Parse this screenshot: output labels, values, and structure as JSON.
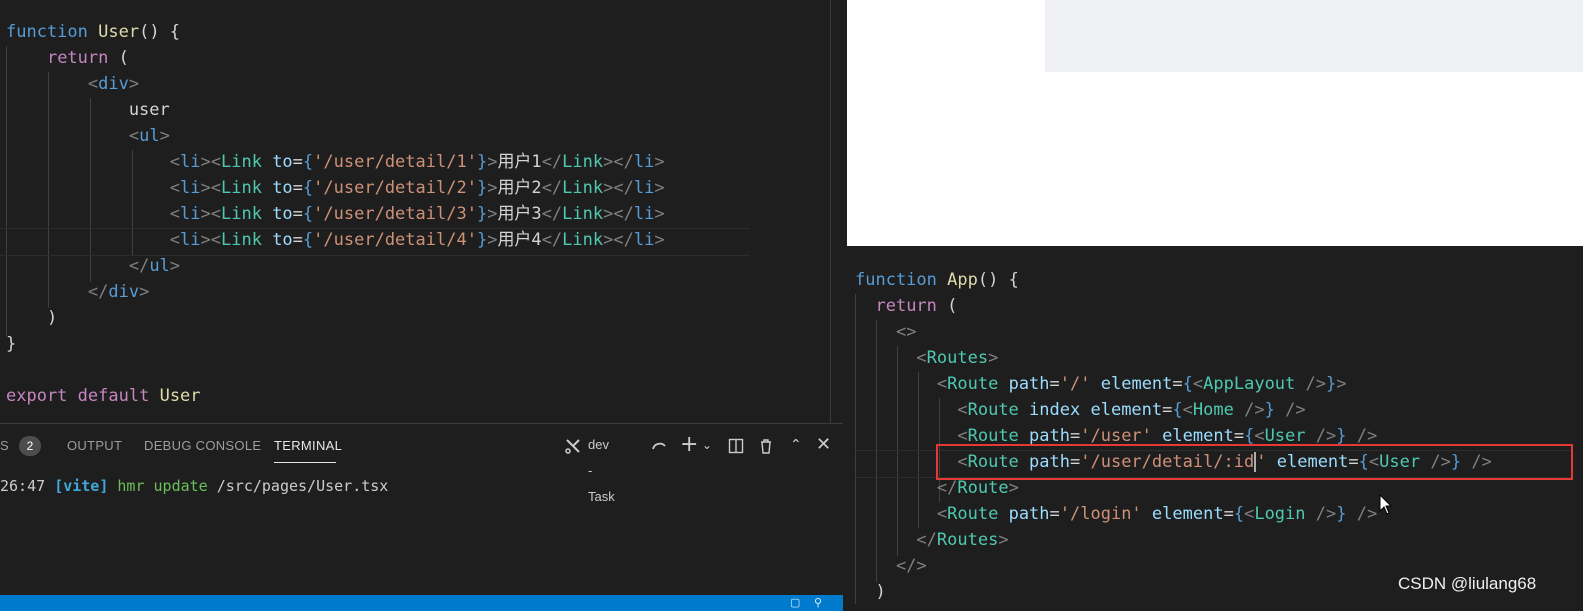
{
  "left_editor": {
    "lines": [
      [
        [
          "kw",
          "function"
        ],
        [
          "txt",
          " "
        ],
        [
          "fn",
          "User"
        ],
        [
          "txt",
          "() {"
        ]
      ],
      [
        [
          "txt",
          "    "
        ],
        [
          "kw2",
          "return"
        ],
        [
          "txt",
          " ("
        ]
      ],
      [
        [
          "txt",
          "        "
        ],
        [
          "punct",
          "<"
        ],
        [
          "kw",
          "div"
        ],
        [
          "punct",
          ">"
        ]
      ],
      [
        [
          "txt",
          "            user"
        ]
      ],
      [
        [
          "txt",
          "            "
        ],
        [
          "punct",
          "<"
        ],
        [
          "kw",
          "ul"
        ],
        [
          "punct",
          ">"
        ]
      ],
      [
        [
          "txt",
          "                "
        ],
        [
          "punct",
          "<"
        ],
        [
          "kw",
          "li"
        ],
        [
          "punct",
          "><"
        ],
        [
          "tag",
          "Link"
        ],
        [
          "txt",
          " "
        ],
        [
          "attr",
          "to"
        ],
        [
          "txt",
          "="
        ],
        [
          "brace",
          "{"
        ],
        [
          "str",
          "'/user/detail/1'"
        ],
        [
          "brace",
          "}"
        ],
        [
          "punct",
          ">"
        ],
        [
          "txt",
          "用户1"
        ],
        [
          "punct",
          "</"
        ],
        [
          "tag",
          "Link"
        ],
        [
          "punct",
          "></"
        ],
        [
          "kw",
          "li"
        ],
        [
          "punct",
          ">"
        ]
      ],
      [
        [
          "txt",
          "                "
        ],
        [
          "punct",
          "<"
        ],
        [
          "kw",
          "li"
        ],
        [
          "punct",
          "><"
        ],
        [
          "tag",
          "Link"
        ],
        [
          "txt",
          " "
        ],
        [
          "attr",
          "to"
        ],
        [
          "txt",
          "="
        ],
        [
          "brace",
          "{"
        ],
        [
          "str",
          "'/user/detail/2'"
        ],
        [
          "brace",
          "}"
        ],
        [
          "punct",
          ">"
        ],
        [
          "txt",
          "用户2"
        ],
        [
          "punct",
          "</"
        ],
        [
          "tag",
          "Link"
        ],
        [
          "punct",
          "></"
        ],
        [
          "kw",
          "li"
        ],
        [
          "punct",
          ">"
        ]
      ],
      [
        [
          "txt",
          "                "
        ],
        [
          "punct",
          "<"
        ],
        [
          "kw",
          "li"
        ],
        [
          "punct",
          "><"
        ],
        [
          "tag",
          "Link"
        ],
        [
          "txt",
          " "
        ],
        [
          "attr",
          "to"
        ],
        [
          "txt",
          "="
        ],
        [
          "brace",
          "{"
        ],
        [
          "str",
          "'/user/detail/3'"
        ],
        [
          "brace",
          "}"
        ],
        [
          "punct",
          ">"
        ],
        [
          "txt",
          "用户3"
        ],
        [
          "punct",
          "</"
        ],
        [
          "tag",
          "Link"
        ],
        [
          "punct",
          "></"
        ],
        [
          "kw",
          "li"
        ],
        [
          "punct",
          ">"
        ]
      ],
      [
        [
          "txt",
          "                "
        ],
        [
          "punct",
          "<"
        ],
        [
          "kw",
          "li"
        ],
        [
          "punct",
          "><"
        ],
        [
          "tag",
          "Link"
        ],
        [
          "txt",
          " "
        ],
        [
          "attr",
          "to"
        ],
        [
          "txt",
          "="
        ],
        [
          "brace",
          "{"
        ],
        [
          "str",
          "'/user/detail/4'"
        ],
        [
          "brace",
          "}"
        ],
        [
          "punct",
          ">"
        ],
        [
          "txt",
          "用户4"
        ],
        [
          "punct",
          "</"
        ],
        [
          "tag",
          "Link"
        ],
        [
          "punct",
          "></"
        ],
        [
          "kw",
          "li"
        ],
        [
          "punct",
          ">"
        ]
      ],
      [
        [
          "txt",
          "            "
        ],
        [
          "punct",
          "</"
        ],
        [
          "kw",
          "ul"
        ],
        [
          "punct",
          ">"
        ]
      ],
      [
        [
          "txt",
          "        "
        ],
        [
          "punct",
          "</"
        ],
        [
          "kw",
          "div"
        ],
        [
          "punct",
          ">"
        ]
      ],
      [
        [
          "txt",
          "    )"
        ]
      ],
      [
        [
          "txt",
          "}"
        ]
      ],
      [
        [
          "txt",
          ""
        ]
      ],
      [
        [
          "kw2",
          "export"
        ],
        [
          "txt",
          " "
        ],
        [
          "kw2",
          "default"
        ],
        [
          "txt",
          " "
        ],
        [
          "fn",
          "User"
        ]
      ]
    ]
  },
  "panel": {
    "problems_tab_partial": "S",
    "problems_badge": "2",
    "tabs": [
      "OUTPUT",
      "DEBUG CONSOLE",
      "TERMINAL"
    ],
    "active_tab": "TERMINAL",
    "task_label": "dev - Task",
    "terminal": {
      "time": "26:47 ",
      "tag": "[vite]",
      "msg": " hmr update",
      "path": " /src/pages/User.tsx"
    }
  },
  "right_editor": {
    "lines": [
      [
        [
          "kw",
          "function"
        ],
        [
          "txt",
          " "
        ],
        [
          "fn",
          "App"
        ],
        [
          "txt",
          "() {"
        ]
      ],
      [
        [
          "txt",
          "  "
        ],
        [
          "kw2",
          "return"
        ],
        [
          "txt",
          " ("
        ]
      ],
      [
        [
          "txt",
          "    "
        ],
        [
          "punct",
          "<>"
        ]
      ],
      [
        [
          "txt",
          "      "
        ],
        [
          "punct",
          "<"
        ],
        [
          "tag",
          "Routes"
        ],
        [
          "punct",
          ">"
        ]
      ],
      [
        [
          "txt",
          "        "
        ],
        [
          "punct",
          "<"
        ],
        [
          "tag",
          "Route"
        ],
        [
          "txt",
          " "
        ],
        [
          "attr",
          "path"
        ],
        [
          "txt",
          "="
        ],
        [
          "str",
          "'/'"
        ],
        [
          "txt",
          " "
        ],
        [
          "attr",
          "element"
        ],
        [
          "txt",
          "="
        ],
        [
          "brace",
          "{"
        ],
        [
          "punct",
          "<"
        ],
        [
          "tag",
          "AppLayout"
        ],
        [
          "txt",
          " "
        ],
        [
          "punct",
          "/>"
        ],
        [
          "brace",
          "}"
        ],
        [
          "punct",
          ">"
        ]
      ],
      [
        [
          "txt",
          "          "
        ],
        [
          "punct",
          "<"
        ],
        [
          "tag",
          "Route"
        ],
        [
          "txt",
          " "
        ],
        [
          "attr",
          "index"
        ],
        [
          "txt",
          " "
        ],
        [
          "attr",
          "element"
        ],
        [
          "txt",
          "="
        ],
        [
          "brace",
          "{"
        ],
        [
          "punct",
          "<"
        ],
        [
          "tag",
          "Home"
        ],
        [
          "txt",
          " "
        ],
        [
          "punct",
          "/>"
        ],
        [
          "brace",
          "}"
        ],
        [
          "txt",
          " "
        ],
        [
          "punct",
          "/>"
        ]
      ],
      [
        [
          "txt",
          "          "
        ],
        [
          "punct",
          "<"
        ],
        [
          "tag",
          "Route"
        ],
        [
          "txt",
          " "
        ],
        [
          "attr",
          "path"
        ],
        [
          "txt",
          "="
        ],
        [
          "str",
          "'/user'"
        ],
        [
          "txt",
          " "
        ],
        [
          "attr",
          "element"
        ],
        [
          "txt",
          "="
        ],
        [
          "brace",
          "{"
        ],
        [
          "punct",
          "<"
        ],
        [
          "tag",
          "User"
        ],
        [
          "txt",
          " "
        ],
        [
          "punct",
          "/>"
        ],
        [
          "brace",
          "}"
        ],
        [
          "txt",
          " "
        ],
        [
          "punct",
          "/>"
        ]
      ],
      [
        [
          "txt",
          "          "
        ],
        [
          "punct",
          "<"
        ],
        [
          "tag",
          "Route"
        ],
        [
          "txt",
          " "
        ],
        [
          "attr",
          "path"
        ],
        [
          "txt",
          "="
        ],
        [
          "str",
          "'/user/detail/:id"
        ],
        [
          "caret",
          ""
        ],
        [
          "str",
          "'"
        ],
        [
          "txt",
          " "
        ],
        [
          "attr",
          "element"
        ],
        [
          "txt",
          "="
        ],
        [
          "brace",
          "{"
        ],
        [
          "punct",
          "<"
        ],
        [
          "tag",
          "User"
        ],
        [
          "txt",
          " "
        ],
        [
          "punct",
          "/>"
        ],
        [
          "brace",
          "}"
        ],
        [
          "txt",
          " "
        ],
        [
          "punct",
          "/>"
        ]
      ],
      [
        [
          "txt",
          "        "
        ],
        [
          "punct",
          "</"
        ],
        [
          "tag",
          "Route"
        ],
        [
          "punct",
          ">"
        ]
      ],
      [
        [
          "txt",
          "        "
        ],
        [
          "punct",
          "<"
        ],
        [
          "tag",
          "Route"
        ],
        [
          "txt",
          " "
        ],
        [
          "attr",
          "path"
        ],
        [
          "txt",
          "="
        ],
        [
          "str",
          "'/login'"
        ],
        [
          "txt",
          " "
        ],
        [
          "attr",
          "element"
        ],
        [
          "txt",
          "="
        ],
        [
          "brace",
          "{"
        ],
        [
          "punct",
          "<"
        ],
        [
          "tag",
          "Login"
        ],
        [
          "txt",
          " "
        ],
        [
          "punct",
          "/>"
        ],
        [
          "brace",
          "}"
        ],
        [
          "txt",
          " "
        ],
        [
          "punct",
          "/>"
        ]
      ],
      [
        [
          "txt",
          "      "
        ],
        [
          "punct",
          "</"
        ],
        [
          "tag",
          "Routes"
        ],
        [
          "punct",
          ">"
        ]
      ],
      [
        [
          "txt",
          "    "
        ],
        [
          "punct",
          "</>"
        ]
      ],
      [
        [
          "txt",
          "  )"
        ]
      ]
    ]
  },
  "watermark": "CSDN @liulang68",
  "colors": {
    "editor_bg": "#1e1e1e",
    "statusbar": "#007acc",
    "highlight": "#e53935"
  }
}
